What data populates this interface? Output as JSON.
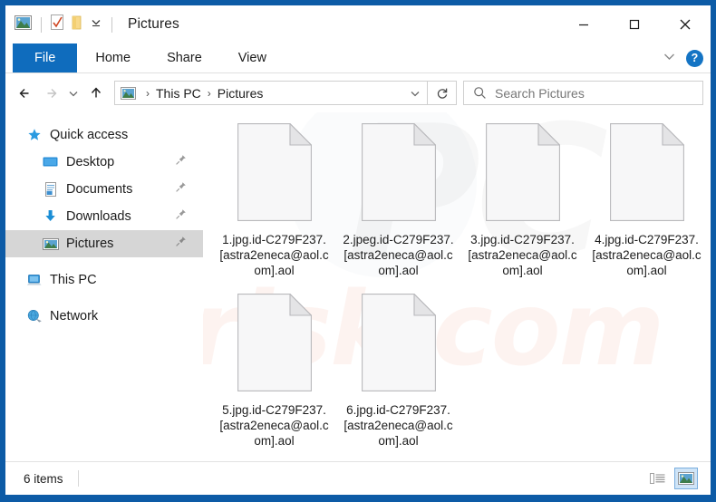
{
  "window": {
    "title": "Pictures",
    "quick_access_toolbar": [
      {
        "name": "pictures-folder-icon",
        "label": "Pictures"
      },
      {
        "name": "properties-icon",
        "label": "Properties"
      },
      {
        "name": "new-folder-icon",
        "label": "New folder"
      },
      {
        "name": "customize-qat-chevron-icon",
        "label": "Customize Quick Access Toolbar"
      }
    ],
    "controls": {
      "minimize": "–",
      "maximize": "□",
      "close": "✕",
      "ribbon_expand": "⌄",
      "help": "?"
    }
  },
  "ribbon": {
    "tabs": [
      {
        "label": "File",
        "active": true
      },
      {
        "label": "Home",
        "active": false
      },
      {
        "label": "Share",
        "active": false
      },
      {
        "label": "View",
        "active": false
      }
    ]
  },
  "addressbar": {
    "back_label": "Back",
    "forward_label": "Forward",
    "recent_label": "Recent locations",
    "up_label": "Up",
    "breadcrumb": [
      "This PC",
      "Pictures"
    ],
    "separator": "›",
    "dropdown_label": "Previous locations",
    "refresh_label": "Refresh"
  },
  "search": {
    "placeholder": "Search Pictures"
  },
  "sidebar": {
    "items": [
      {
        "label": "Quick access",
        "icon": "star-icon",
        "indent": false,
        "selected": false,
        "pinned": false
      },
      {
        "label": "Desktop",
        "icon": "desktop-icon",
        "indent": true,
        "selected": false,
        "pinned": true
      },
      {
        "label": "Documents",
        "icon": "documents-icon",
        "indent": true,
        "selected": false,
        "pinned": true
      },
      {
        "label": "Downloads",
        "icon": "downloads-icon",
        "indent": true,
        "selected": false,
        "pinned": true
      },
      {
        "label": "Pictures",
        "icon": "pictures-icon",
        "indent": true,
        "selected": true,
        "pinned": true
      },
      {
        "label": "This PC",
        "icon": "this-pc-icon",
        "indent": false,
        "selected": false,
        "pinned": false
      },
      {
        "label": "Network",
        "icon": "network-icon",
        "indent": false,
        "selected": false,
        "pinned": false
      }
    ]
  },
  "files": [
    {
      "name": "1.jpg.id-C279F237.[astra2eneca@aol.com].aol",
      "icon": "blank-file-icon"
    },
    {
      "name": "2.jpeg.id-C279F237.[astra2eneca@aol.com].aol",
      "icon": "blank-file-icon"
    },
    {
      "name": "3.jpg.id-C279F237.[astra2eneca@aol.com].aol",
      "icon": "blank-file-icon"
    },
    {
      "name": "4.jpg.id-C279F237.[astra2eneca@aol.com].aol",
      "icon": "blank-file-icon"
    },
    {
      "name": "5.jpg.id-C279F237.[astra2eneca@aol.com].aol",
      "icon": "blank-file-icon"
    },
    {
      "name": "6.jpg.id-C279F237.[astra2eneca@aol.com].aol",
      "icon": "blank-file-icon"
    }
  ],
  "watermarks": {
    "primary": "PC",
    "secondary": "risk.com"
  },
  "statusbar": {
    "item_count": "6 items",
    "view_details_label": "Details view",
    "view_large_icons_label": "Large icons view"
  },
  "colors": {
    "window_border": "#0d5ba6",
    "file_tab": "#0f6cbd",
    "selection": "#d6d6d6",
    "help_blue": "#1474c4"
  }
}
